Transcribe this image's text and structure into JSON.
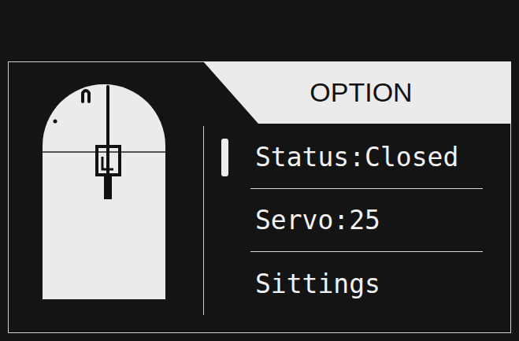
{
  "header": {
    "title": "OPTION"
  },
  "menu": [
    {
      "label": "Status:Closed",
      "selected": true
    },
    {
      "label": "Servo:25",
      "selected": false
    },
    {
      "label": "Sittings",
      "selected": false
    }
  ]
}
